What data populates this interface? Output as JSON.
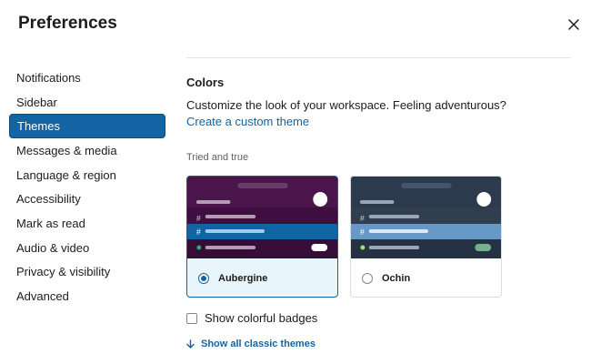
{
  "header": {
    "title": "Preferences",
    "close_icon": "close-icon"
  },
  "sidebar": {
    "items": [
      {
        "label": "Notifications",
        "active": false
      },
      {
        "label": "Sidebar",
        "active": false
      },
      {
        "label": "Themes",
        "active": true
      },
      {
        "label": "Messages & media",
        "active": false
      },
      {
        "label": "Language & region",
        "active": false
      },
      {
        "label": "Accessibility",
        "active": false
      },
      {
        "label": "Mark as read",
        "active": false
      },
      {
        "label": "Audio & video",
        "active": false
      },
      {
        "label": "Privacy & visibility",
        "active": false
      },
      {
        "label": "Advanced",
        "active": false
      }
    ]
  },
  "main": {
    "section_title": "Colors",
    "description": "Customize the look of your workspace. Feeling adventurous?",
    "custom_theme_link": "Create a custom theme",
    "group_label": "Tried and true",
    "themes": [
      {
        "name": "Aubergine",
        "selected": true,
        "colors": {
          "top": "#4a154b",
          "sidebar": "#3f0e40",
          "highlight": "#1164a3",
          "bottom": "#350d36"
        }
      },
      {
        "name": "Ochin",
        "selected": false,
        "colors": {
          "top": "#2c3a4e",
          "sidebar": "#303e4d",
          "highlight": "#6698c8",
          "bottom": "#253244"
        }
      }
    ],
    "badges_checkbox": {
      "label": "Show colorful badges",
      "checked": false
    },
    "show_all_link": "Show all classic themes",
    "show_all_icon": "arrow-down-icon"
  },
  "colors": {
    "accent": "#1264a3",
    "active_nav": "#1264a3",
    "selected_card_bg": "#e8f5fa"
  }
}
